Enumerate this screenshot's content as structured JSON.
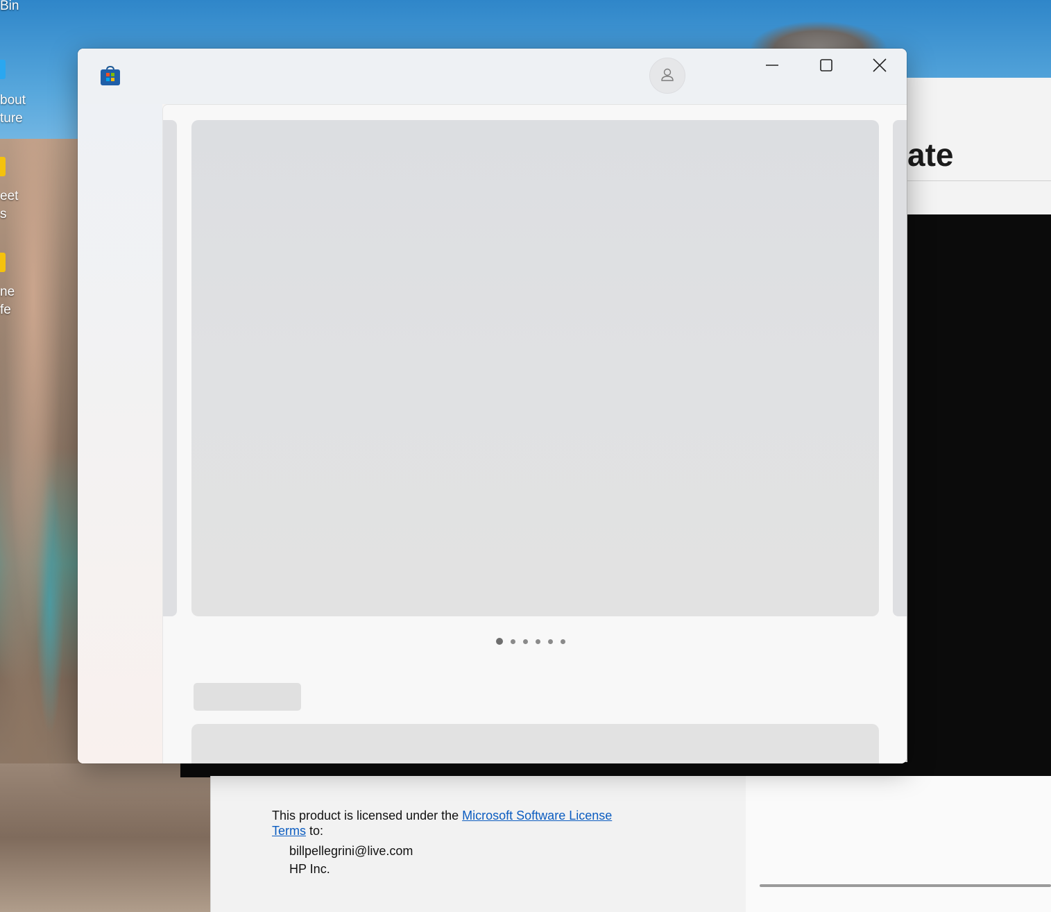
{
  "desktop": {
    "labels": [
      "Bin",
      "bout\nture",
      "eet\ns",
      "ne\nfe"
    ]
  },
  "background_app": {
    "heading_fragment": "ate"
  },
  "about_dialog": {
    "license_prefix": "This product is licensed under the ",
    "license_link": "Microsoft Software License Terms",
    "license_suffix": " to:",
    "licensed_user": "billpellegrini@live.com",
    "licensed_org": "HP Inc."
  },
  "store_window": {
    "app_icon": "microsoft-store-icon",
    "profile_icon": "user-icon",
    "controls": {
      "minimize": "minimize-icon",
      "maximize": "maximize-icon",
      "close": "close-icon"
    },
    "carousel": {
      "page_count": 6,
      "active_index": 0
    }
  }
}
